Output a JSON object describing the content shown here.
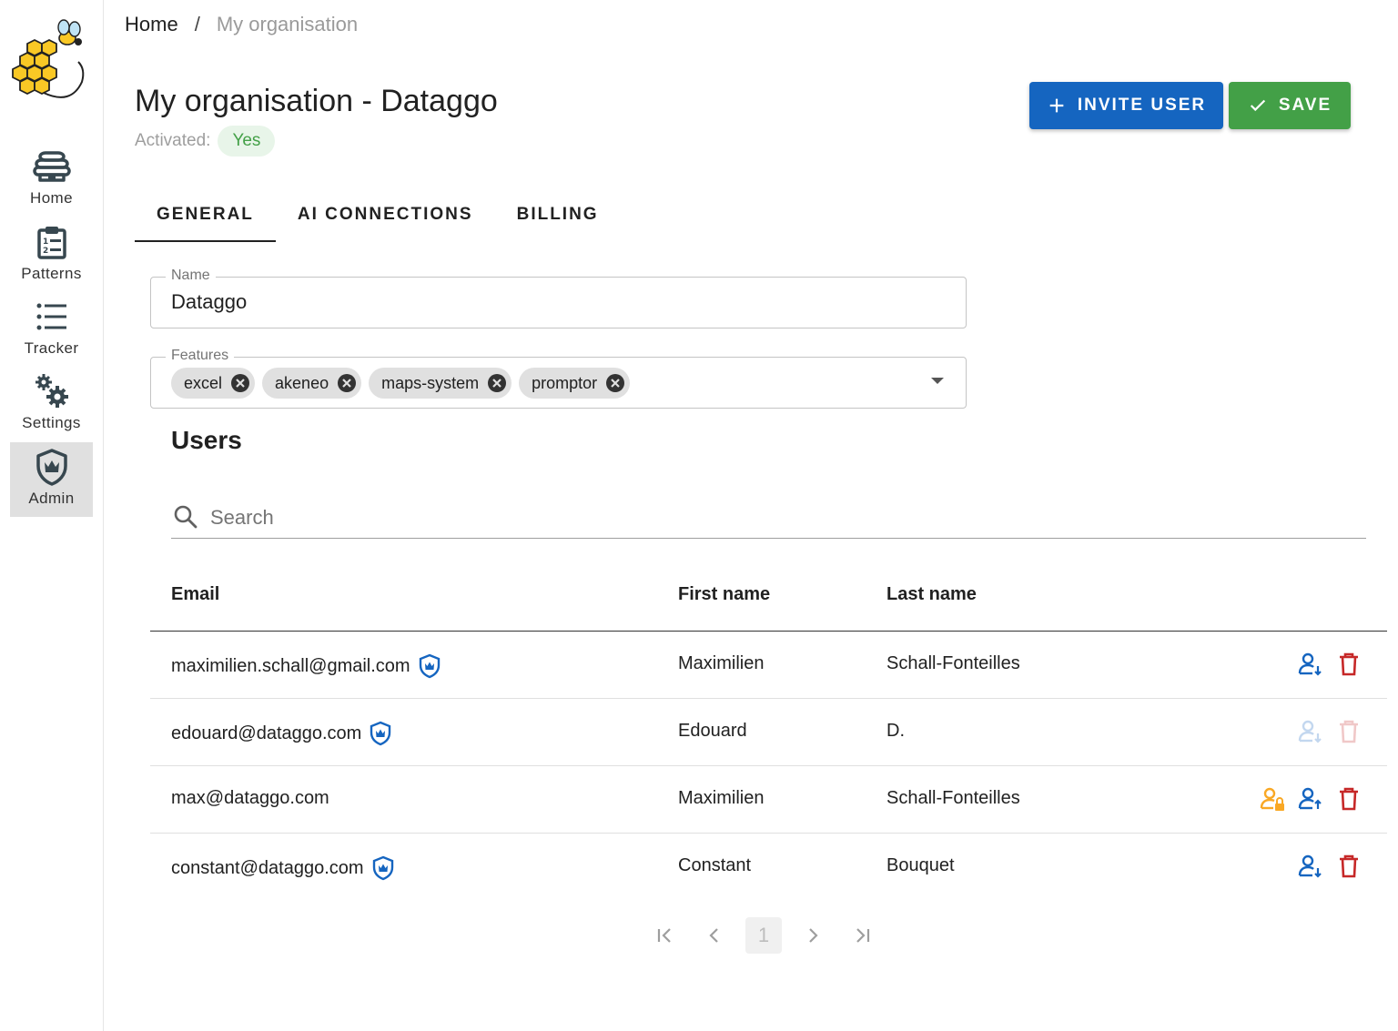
{
  "sidebar": {
    "items": [
      {
        "label": "Home",
        "icon": "beehive-icon"
      },
      {
        "label": "Patterns",
        "icon": "clipboard-list-icon"
      },
      {
        "label": "Tracker",
        "icon": "list-icon"
      },
      {
        "label": "Settings",
        "icon": "gears-icon"
      },
      {
        "label": "Admin",
        "icon": "shield-crown-icon"
      }
    ],
    "active": "Admin"
  },
  "breadcrumb": {
    "home": "Home",
    "separator": "/",
    "current": "My organisation"
  },
  "page": {
    "title": "My organisation - Dataggo",
    "activated_label": "Activated:",
    "activated_value": "Yes"
  },
  "toolbar": {
    "invite_label": "INVITE USER",
    "save_label": "SAVE"
  },
  "tabs": [
    {
      "label": "GENERAL"
    },
    {
      "label": "AI CONNECTIONS"
    },
    {
      "label": "BILLING"
    }
  ],
  "form": {
    "name_label": "Name",
    "name_value": "Dataggo",
    "features_label": "Features",
    "features": [
      "excel",
      "akeneo",
      "maps-system",
      "promptor"
    ]
  },
  "users": {
    "title": "Users",
    "search_placeholder": "Search",
    "columns": {
      "email": "Email",
      "first": "First name",
      "last": "Last name"
    },
    "rows": [
      {
        "email": "maximilien.schall@gmail.com",
        "first": "Maximilien",
        "last": "Schall-Fonteilles",
        "admin": true
      },
      {
        "email": "edouard@dataggo.com",
        "first": "Edouard",
        "last": "D.",
        "admin": true
      },
      {
        "email": "max@dataggo.com",
        "first": "Maximilien",
        "last": "Schall-Fonteilles",
        "admin": false
      },
      {
        "email": "constant@dataggo.com",
        "first": "Constant",
        "last": "Bouquet",
        "admin": true
      }
    ]
  },
  "pagination": {
    "current_page": "1"
  },
  "colors": {
    "primary": "#1565c0",
    "success": "#43a047",
    "danger": "#c62828",
    "warning": "#f9a825"
  }
}
